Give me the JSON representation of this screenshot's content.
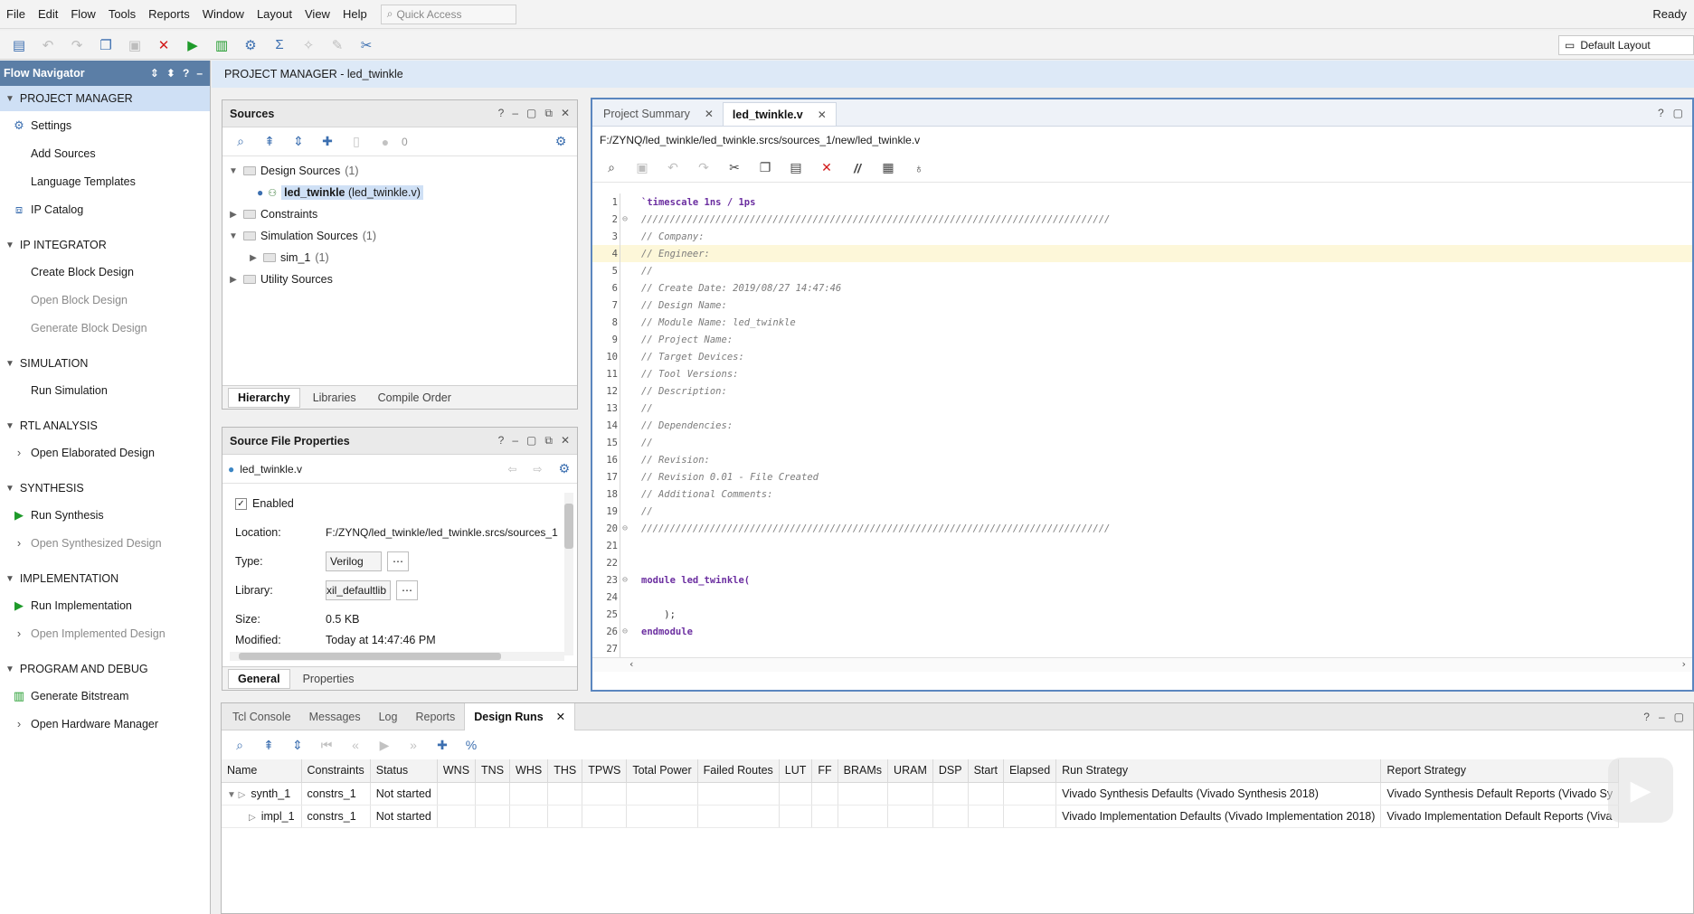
{
  "menu": [
    "File",
    "Edit",
    "Flow",
    "Tools",
    "Reports",
    "Window",
    "Layout",
    "View",
    "Help"
  ],
  "quick_access_placeholder": "Quick Access",
  "status": "Ready",
  "layout_select": "Default Layout",
  "flow_navigator": {
    "title": "Flow Navigator",
    "sections": [
      {
        "label": "PROJECT MANAGER",
        "items": [
          {
            "label": "Settings",
            "icon": "gear-icon",
            "disabled": false
          },
          {
            "label": "Add Sources",
            "icon": "",
            "disabled": false
          },
          {
            "label": "Language Templates",
            "icon": "",
            "disabled": false
          },
          {
            "label": "IP Catalog",
            "icon": "ip-icon",
            "disabled": false
          }
        ]
      },
      {
        "label": "IP INTEGRATOR",
        "items": [
          {
            "label": "Create Block Design",
            "icon": "",
            "disabled": false
          },
          {
            "label": "Open Block Design",
            "icon": "",
            "disabled": true
          },
          {
            "label": "Generate Block Design",
            "icon": "",
            "disabled": true
          }
        ]
      },
      {
        "label": "SIMULATION",
        "items": [
          {
            "label": "Run Simulation",
            "icon": "",
            "disabled": false
          }
        ]
      },
      {
        "label": "RTL ANALYSIS",
        "items": [
          {
            "label": "Open Elaborated Design",
            "icon": "chevron-right-icon",
            "disabled": false
          }
        ]
      },
      {
        "label": "SYNTHESIS",
        "items": [
          {
            "label": "Run Synthesis",
            "icon": "play-icon",
            "disabled": false
          },
          {
            "label": "Open Synthesized Design",
            "icon": "chevron-right-icon",
            "disabled": true
          }
        ]
      },
      {
        "label": "IMPLEMENTATION",
        "items": [
          {
            "label": "Run Implementation",
            "icon": "play-icon",
            "disabled": false
          },
          {
            "label": "Open Implemented Design",
            "icon": "chevron-right-icon",
            "disabled": true
          }
        ]
      },
      {
        "label": "PROGRAM AND DEBUG",
        "items": [
          {
            "label": "Generate Bitstream",
            "icon": "bitstream-icon",
            "disabled": false
          },
          {
            "label": "Open Hardware Manager",
            "icon": "chevron-right-icon",
            "disabled": false
          }
        ]
      }
    ]
  },
  "project_manager_bar": "PROJECT MANAGER - led_twinkle",
  "sources": {
    "title": "Sources",
    "count": "0",
    "tree": {
      "design_sources": "Design Sources",
      "design_sources_count": "(1)",
      "top_module": "led_twinkle",
      "top_module_file": "(led_twinkle.v)",
      "constraints": "Constraints",
      "simulation_sources": "Simulation Sources",
      "simulation_sources_count": "(1)",
      "sim_1": "sim_1",
      "sim_1_count": "(1)",
      "utility_sources": "Utility Sources"
    },
    "tabs": [
      "Hierarchy",
      "Libraries",
      "Compile Order"
    ]
  },
  "file_props": {
    "title": "Source File Properties",
    "file": "led_twinkle.v",
    "enabled_label": "Enabled",
    "location_label": "Location:",
    "location": "F:/ZYNQ/led_twinkle/led_twinkle.srcs/sources_1",
    "type_label": "Type:",
    "type": "Verilog",
    "library_label": "Library:",
    "library": "xil_defaultlib",
    "size_label": "Size:",
    "size": "0.5 KB",
    "modified_label": "Modified:",
    "modified": "Today at 14:47:46 PM",
    "tabs": [
      "General",
      "Properties"
    ]
  },
  "editor": {
    "tabs": [
      "Project Summary",
      "led_twinkle.v"
    ],
    "path": "F:/ZYNQ/led_twinkle/led_twinkle.srcs/sources_1/new/led_twinkle.v",
    "lines": [
      "`timescale 1ns / 1ps",
      "//////////////////////////////////////////////////////////////////////////////////",
      "// Company: ",
      "// Engineer: ",
      "// ",
      "// Create Date: 2019/08/27 14:47:46",
      "// Design Name: ",
      "// Module Name: led_twinkle",
      "// Project Name: ",
      "// Target Devices: ",
      "// Tool Versions: ",
      "// Description: ",
      "// ",
      "// Dependencies: ",
      "// ",
      "// Revision:",
      "// Revision 0.01 - File Created",
      "// Additional Comments:",
      "// ",
      "//////////////////////////////////////////////////////////////////////////////////",
      "",
      "",
      "module led_twinkle(",
      "",
      "    );",
      "endmodule",
      ""
    ]
  },
  "bottom": {
    "tabs": [
      "Tcl Console",
      "Messages",
      "Log",
      "Reports",
      "Design Runs"
    ],
    "columns": [
      "Name",
      "Constraints",
      "Status",
      "WNS",
      "TNS",
      "WHS",
      "THS",
      "TPWS",
      "Total Power",
      "Failed Routes",
      "LUT",
      "FF",
      "BRAMs",
      "URAM",
      "DSP",
      "Start",
      "Elapsed",
      "Run Strategy",
      "Report Strategy"
    ],
    "rows": [
      {
        "name": "synth_1",
        "constraints": "constrs_1",
        "status": "Not started",
        "run_strategy": "Vivado Synthesis Defaults (Vivado Synthesis 2018)",
        "report_strategy": "Vivado Synthesis Default Reports (Vivado Sy"
      },
      {
        "name": "impl_1",
        "constraints": "constrs_1",
        "status": "Not started",
        "run_strategy": "Vivado Implementation Defaults (Vivado Implementation 2018)",
        "report_strategy": "Vivado Implementation Default Reports (Viva"
      }
    ]
  }
}
